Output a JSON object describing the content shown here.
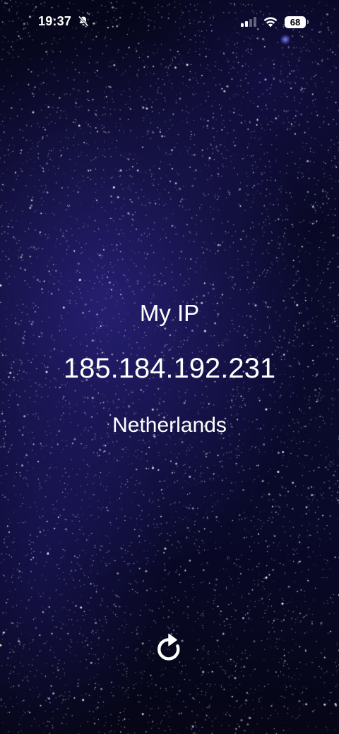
{
  "status_bar": {
    "time": "19:37",
    "battery_level": "68",
    "icons": [
      "bell-slash-icon",
      "cellular-signal-icon",
      "wifi-icon",
      "battery-icon"
    ]
  },
  "main": {
    "title": "My IP",
    "ip_address": "185.184.192.231",
    "country": "Netherlands"
  },
  "actions": {
    "refresh_icon": "refresh-icon"
  },
  "colors": {
    "background": "#07071c",
    "nebula": "#3c30aa",
    "text": "#ffffff"
  }
}
